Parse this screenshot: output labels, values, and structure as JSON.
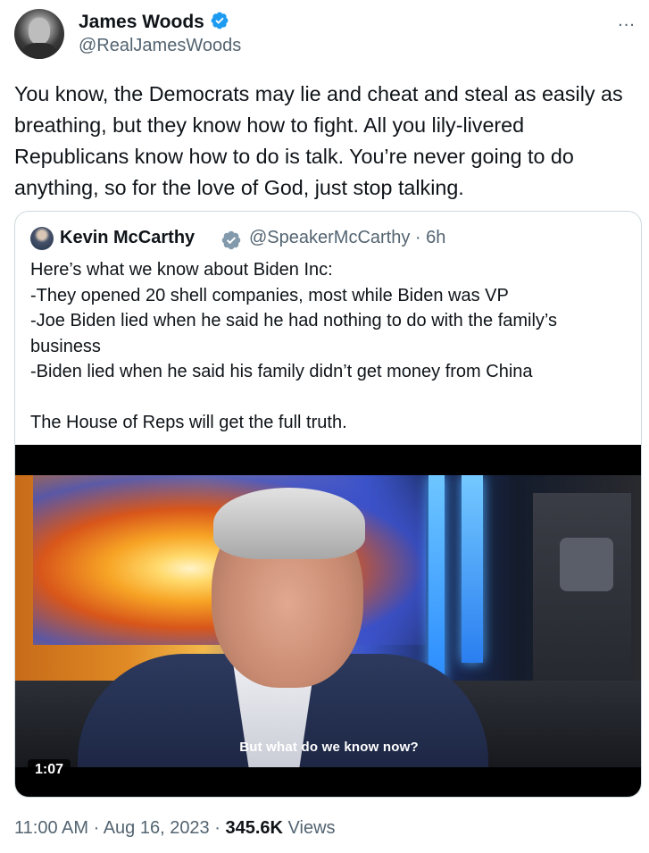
{
  "author": {
    "display_name": "James Woods",
    "handle": "@RealJamesWoods",
    "verified": true,
    "verified_color": "#1d9bf0"
  },
  "more_icon": "...",
  "tweet": {
    "text": "You know, the Democrats may lie and cheat and steal as easily as breathing, but they know how to fight. All you lily-livered Republicans know how to do is talk. You’re never going to do anything, so for the love of God, just stop talking."
  },
  "quoted_tweet": {
    "display_name": "Kevin McCarthy",
    "handle_time": "@SpeakerMcCarthy · 6h",
    "verified": true,
    "lines": [
      "Here’s what we know about Biden Inc:",
      "-They opened 20 shell companies, most while Biden was VP",
      "-Joe Biden lied when he said he had nothing to do with the family’s business",
      "-Biden lied when he said his family didn’t get money from China",
      "The House of Reps will get the full truth."
    ],
    "video": {
      "caption": "But what do we know now?",
      "duration": "1:07"
    }
  },
  "meta": {
    "time_date": "11:00 AM · Aug 16, 2023 · ",
    "views_count": "345.6K",
    "views_label": " Views"
  }
}
